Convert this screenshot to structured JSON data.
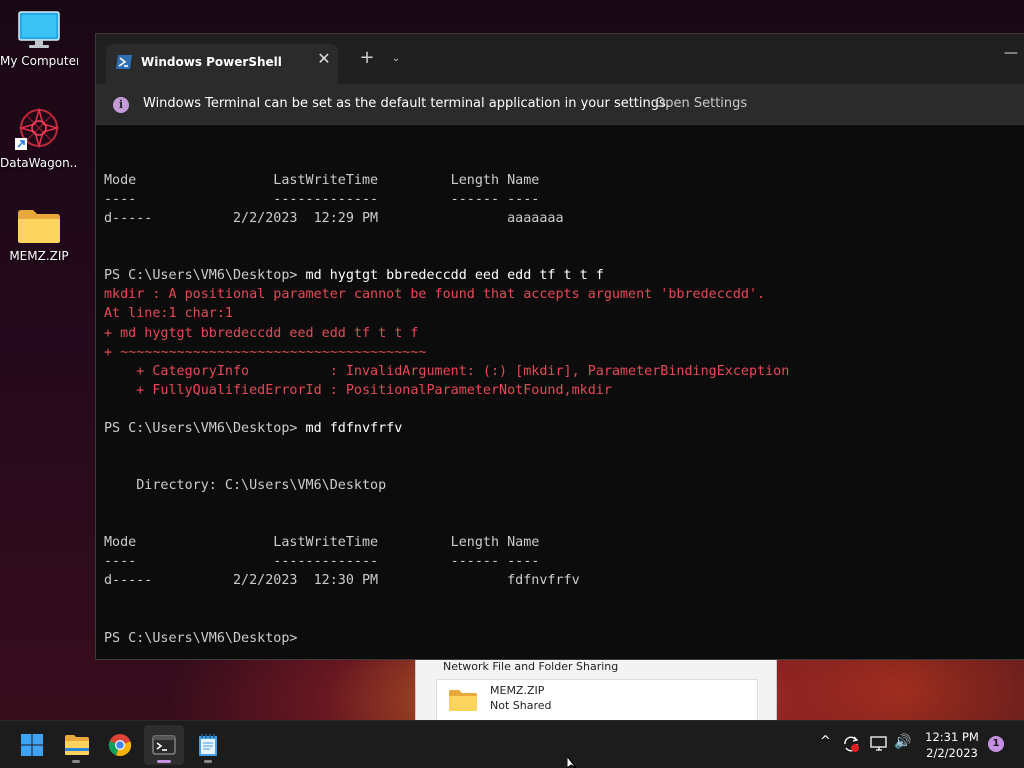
{
  "desktop": {
    "icons": [
      {
        "label": "My Computer",
        "icon": "monitor-icon"
      },
      {
        "label": "DataWagon...",
        "icon": "datawagon-shortcut-icon"
      },
      {
        "label": "MEMZ.ZIP",
        "icon": "folder-icon"
      }
    ]
  },
  "background_dialog": {
    "heading": "Network File and Folder Sharing",
    "item_name": "MEMZ.ZIP",
    "item_status": "Not Shared"
  },
  "terminal": {
    "tab_title": "Windows PowerShell",
    "close_glyph": "✕",
    "new_tab_glyph": "+",
    "dropdown_glyph": "⌄",
    "minimize_glyph": "—",
    "info_text": "Windows Terminal can be set as the default terminal application in your settings.",
    "info_link": "Open Settings",
    "lines": [
      {
        "text": "Mode                 LastWriteTime         Length Name",
        "style": "normal"
      },
      {
        "text": "----                 -------------         ------ ----",
        "style": "normal"
      },
      {
        "text": "d-----          2/2/2023  12:29 PM                aaaaaaa",
        "style": "normal"
      },
      {
        "text": "",
        "style": "normal"
      },
      {
        "text": "",
        "style": "normal"
      },
      {
        "text": "PS C:\\Users\\VM6\\Desktop> md hygtgt bbredeccdd eed edd tf t t f",
        "style": "cmd"
      },
      {
        "text": "mkdir : A positional parameter cannot be found that accepts argument 'bbredeccdd'.",
        "style": "err"
      },
      {
        "text": "At line:1 char:1",
        "style": "err"
      },
      {
        "text": "+ md hygtgt bbredeccdd eed edd tf t t f",
        "style": "err"
      },
      {
        "text": "+ ~~~~~~~~~~~~~~~~~~~~~~~~~~~~~~~~~~~~~~",
        "style": "err"
      },
      {
        "text": "    + CategoryInfo          : InvalidArgument: (:) [mkdir], ParameterBindingException",
        "style": "err"
      },
      {
        "text": "    + FullyQualifiedErrorId : PositionalParameterNotFound,mkdir",
        "style": "err"
      },
      {
        "text": "",
        "style": "normal"
      },
      {
        "text": "PS C:\\Users\\VM6\\Desktop> md fdfnvfrfv",
        "style": "cmd"
      },
      {
        "text": "",
        "style": "normal"
      },
      {
        "text": "",
        "style": "normal"
      },
      {
        "text": "    Directory: C:\\Users\\VM6\\Desktop",
        "style": "normal"
      },
      {
        "text": "",
        "style": "normal"
      },
      {
        "text": "",
        "style": "normal"
      },
      {
        "text": "Mode                 LastWriteTime         Length Name",
        "style": "normal"
      },
      {
        "text": "----                 -------------         ------ ----",
        "style": "normal"
      },
      {
        "text": "d-----          2/2/2023  12:30 PM                fdfnvfrfv",
        "style": "normal"
      },
      {
        "text": "",
        "style": "normal"
      },
      {
        "text": "",
        "style": "normal"
      },
      {
        "text": "PS C:\\Users\\VM6\\Desktop>",
        "style": "normal"
      }
    ]
  },
  "taskbar": {
    "apps": [
      {
        "name": "start-button",
        "icon": "windows-logo-icon"
      },
      {
        "name": "file-explorer",
        "icon": "folder-icon"
      },
      {
        "name": "chrome",
        "icon": "chrome-icon"
      },
      {
        "name": "terminal",
        "icon": "terminal-icon",
        "active": true
      },
      {
        "name": "notepad",
        "icon": "notepad-icon"
      }
    ],
    "tray": {
      "chevron_glyph": "^",
      "volume_glyph": "🔊"
    },
    "clock_time": "12:31 PM",
    "clock_date": "2/2/2023",
    "notification_count": "1"
  },
  "colors": {
    "terminal_bg": "#0c0c0c",
    "error_text": "#e74856",
    "accent": "#c590e0"
  }
}
